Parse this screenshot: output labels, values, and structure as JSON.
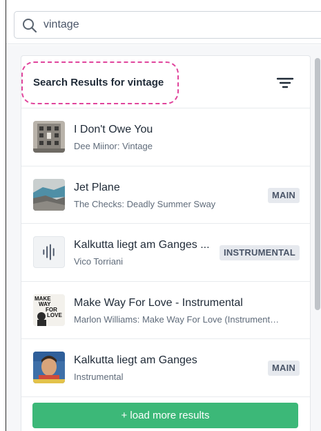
{
  "search": {
    "value": "vintage",
    "placeholder": ""
  },
  "results": {
    "title": "Search Results for vintage",
    "load_more_label": "+ load more results"
  },
  "tracks": [
    {
      "title": "I Don't Owe You",
      "subtitle": "Dee Miinor: Vintage",
      "badge": "",
      "artwork": "building-photo"
    },
    {
      "title": "Jet Plane",
      "subtitle": "The Checks: Deadly Summer Sway",
      "badge": "MAIN",
      "artwork": "landscape-photo"
    },
    {
      "title": "Kalkutta liegt am Ganges ...",
      "subtitle": "Vico Torriani",
      "badge": "INSTRUMENTAL",
      "artwork": "audio-waveform-placeholder"
    },
    {
      "title": "Make Way For Love - Instrumental",
      "subtitle": "Marlon Williams: Make Way For Love (Instrument…",
      "badge": "",
      "artwork": "album-cover-text",
      "artwork_text": [
        "MAKE",
        "WAY",
        "FOR",
        "LOVE"
      ]
    },
    {
      "title": "Kalkutta liegt am Ganges",
      "subtitle": "Instrumental",
      "badge": "MAIN",
      "artwork": "portrait-photo"
    }
  ],
  "icons": {
    "search": "search-icon",
    "filter": "filter-icon",
    "waveform": "waveform-icon"
  },
  "colors": {
    "highlight": "#e0449c",
    "load_more": "#3cb878",
    "badge_bg": "#e6e9ee"
  }
}
